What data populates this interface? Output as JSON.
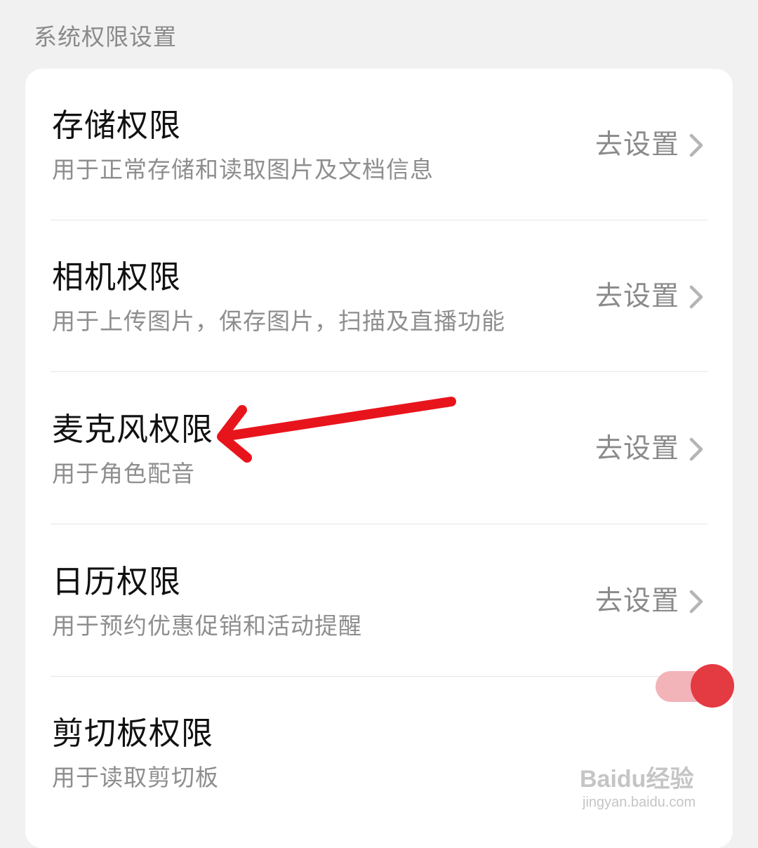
{
  "section_title": "系统权限设置",
  "permissions": [
    {
      "title": "存储权限",
      "desc": "用于正常存储和读取图片及文档信息",
      "action": "去设置"
    },
    {
      "title": "相机权限",
      "desc": "用于上传图片，保存图片，扫描及直播功能",
      "action": "去设置"
    },
    {
      "title": "麦克风权限",
      "desc": "用于角色配音",
      "action": "去设置"
    },
    {
      "title": "日历权限",
      "desc": "用于预约优惠促销和活动提醒",
      "action": "去设置"
    },
    {
      "title": "剪切板权限",
      "desc": "用于读取剪切板",
      "toggle": "on"
    }
  ],
  "colors": {
    "accent": "#e43a42",
    "annotation_arrow": "#e8141c"
  },
  "icons": {
    "chevron": "chevron-right-icon",
    "arrow": "annotation-arrow-icon"
  },
  "watermark": {
    "brand": "Baidu经验",
    "url": "jingyan.baidu.com"
  }
}
